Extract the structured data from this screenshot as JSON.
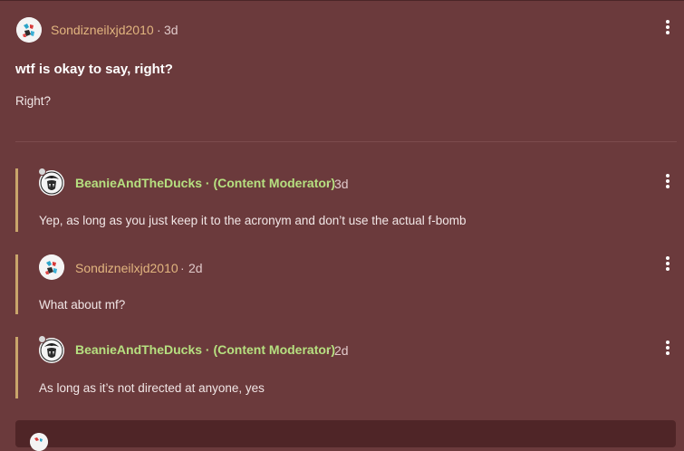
{
  "post": {
    "author": "Sondizneilxjd2010",
    "separator": "·",
    "age": "3d",
    "title": "wtf is okay to say, right?",
    "body": "Right?"
  },
  "comments": [
    {
      "author": "BeanieAndTheDucks · (Content Moderator)",
      "separator": "·",
      "age": "3d",
      "text": "Yep, as long as you just keep it to the acronym and don’t use the actual f-bomb"
    },
    {
      "author": "Sondizneilxjd2010",
      "separator": "·",
      "age": "2d",
      "text": "What about mf?"
    },
    {
      "author": "BeanieAndTheDucks · (Content Moderator)",
      "separator": "·",
      "age": "2d",
      "text": "As long as it’s not directed at anyone, yes"
    }
  ],
  "icons": {
    "menu": "more-vertical-icon",
    "online": "online-status-icon"
  },
  "colors": {
    "background": "#6b3a3c",
    "username": "#e2b57f",
    "moderator": "#b6e080",
    "thread_line": "#c9a56b",
    "reply_box": "#4f2527"
  }
}
